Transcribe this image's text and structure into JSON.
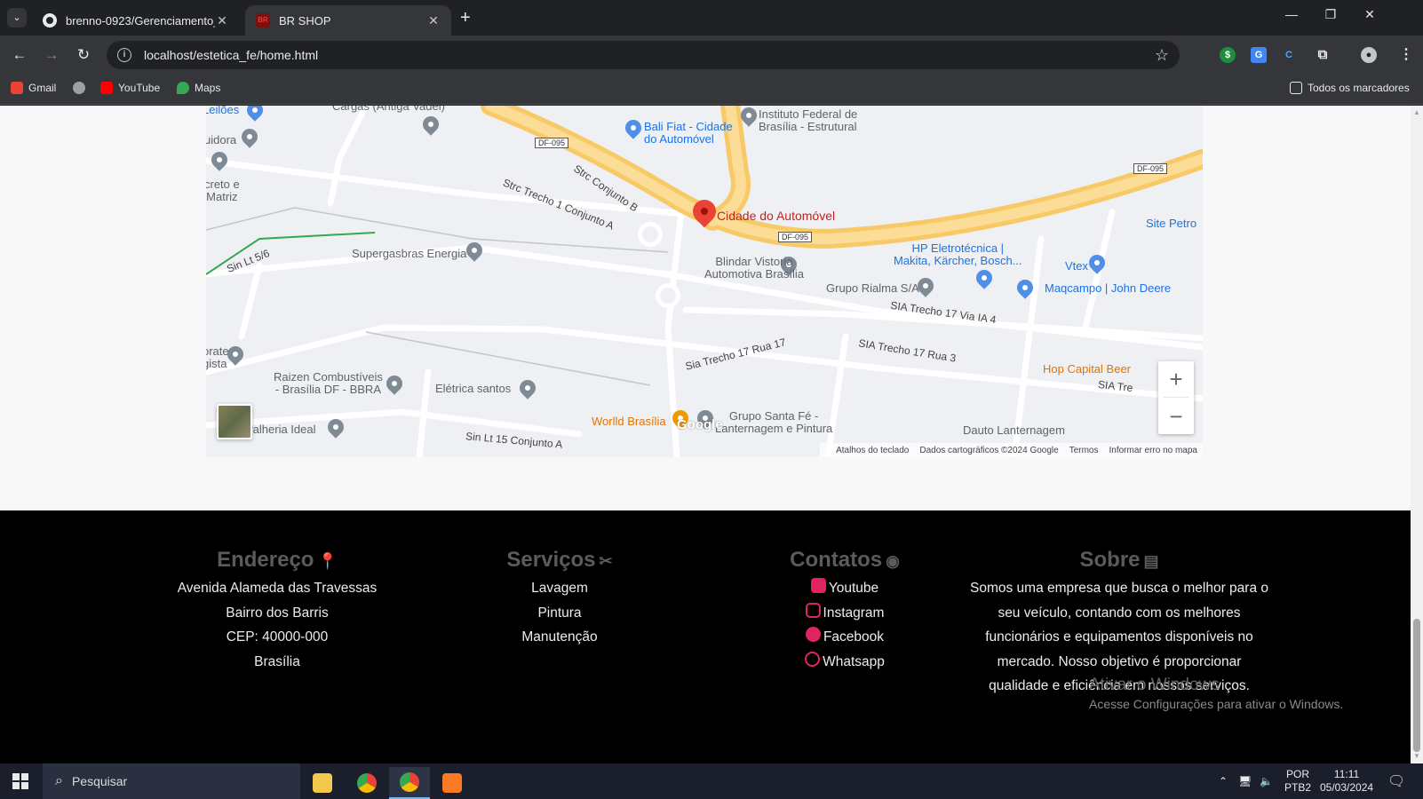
{
  "browser": {
    "tabs": [
      {
        "title": "brenno-0923/Gerenciamento_e",
        "active": false,
        "close": "✕"
      },
      {
        "title": "BR SHOP",
        "active": true,
        "close": "✕"
      }
    ],
    "new_tab": "+",
    "window_controls": {
      "minimize": "—",
      "restore": "❐",
      "close": "✕"
    },
    "url": "localhost/estetica_fe/home.html",
    "bookmarks": [
      "Gmail",
      "YouTube",
      "Maps"
    ],
    "all_bookmarks": "Todos os marcadores"
  },
  "map": {
    "main_place": "Cidade do Automóvel",
    "labels": {
      "leiloes": "Leilões",
      "cargas": "Cargas (Antiga Vadel)",
      "buidora": "uidora",
      "creto": "creto e\nMatriz",
      "bali": "Bali Fiat - Cidade\ndo Automóvel",
      "instituto": "Instituto Federal de\nBrasília - Estrutural",
      "strc_b": "Strc Conjunto B",
      "strc_a": "Strc Trecho 1 Conjunto A",
      "site_petro": "Site Petro",
      "sin_lt": "Sin Lt 5/6",
      "supergasbras": "Supergasbras Energia",
      "hp": "HP Eletrotécnica |\nMakita, Kärcher, Bosch...",
      "vtex": "Vtex",
      "blindar": "Blindar Vistoria\nAutomotiva Brasília",
      "rialma": "Grupo Rialma S/A",
      "maqcampo": "Maqcampo | John Deere",
      "sia_via": "SIA Trecho 17 Via IA 4",
      "sia_rua": "SIA Trecho 17 Rua 3",
      "sia_rua17": "Sia Trecho 17 Rua 17",
      "sia_tre": "SIA Tre",
      "hop": "Hop Capital Beer",
      "orate": "orate\ngista",
      "raizen": "Raizen Combustíveis\n- Brasília DF - BBRA",
      "eletrica": "Elétrica santos",
      "worlld": "Worlld Brasília",
      "santa_fe": "Grupo Santa Fé -\nLanternagem e Pintura",
      "dauto": "Dauto Lanternagem",
      "serralheria": "rralheria Ideal",
      "sin_lt15": "Sin Lt 15 Conjunto A"
    },
    "road_shields": [
      "DF-095",
      "DF-095",
      "DF-095"
    ],
    "zoom_in": "+",
    "zoom_out": "−",
    "google_logo": "Google",
    "attribution": [
      "Atalhos do teclado",
      "Dados cartográficos ©2024 Google",
      "Termos",
      "Informar erro no mapa"
    ]
  },
  "footer": {
    "address": {
      "title": "Endereço",
      "lines": [
        "Avenida Alameda das Travessas",
        "Bairro dos Barris",
        "CEP: 40000-000",
        "Brasília"
      ]
    },
    "services": {
      "title": "Serviços",
      "lines": [
        "Lavagem",
        "Pintura",
        "Manutenção"
      ]
    },
    "contacts": {
      "title": "Contatos",
      "items": [
        "Youtube",
        "Instagram",
        "Facebook",
        "Whatsapp"
      ]
    },
    "about": {
      "title": "Sobre",
      "lines": [
        "Somos uma empresa que busca o melhor para o",
        "seu veículo, contando com os melhores",
        "funcionários e equipamentos disponíveis no",
        "mercado. Nosso objetivo é proporcionar",
        "qualidade e eficiência em nossos serviços."
      ]
    }
  },
  "watermark": {
    "title": "Ativar o Windows",
    "subtitle": "Acesse Configurações para ativar o Windows."
  },
  "taskbar": {
    "search_placeholder": "Pesquisar",
    "lang_top": "POR",
    "lang_bottom": "PTB2",
    "time": "11:11",
    "date": "05/03/2024"
  },
  "colors": {
    "accent_red": "#c5221f",
    "footer_bg": "#000000",
    "brand_pink": "#e0245e"
  }
}
